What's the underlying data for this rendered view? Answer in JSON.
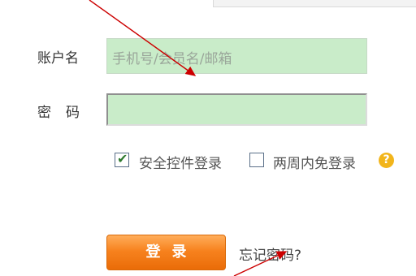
{
  "form": {
    "username_label": "账户名",
    "username_placeholder": "手机号/会员名/邮箱",
    "password_label": "密码",
    "security_control_label": "安全控件登录",
    "remember_two_weeks_label": "两周内免登录",
    "help_glyph": "?",
    "login_button": "登录",
    "forgot_password_link": "忘记密码?"
  },
  "colors": {
    "input_bg": "#c9ecc9",
    "button_orange": "#f7821e",
    "help_badge": "#f2b51b",
    "annotation_arrow": "#cc0000"
  }
}
